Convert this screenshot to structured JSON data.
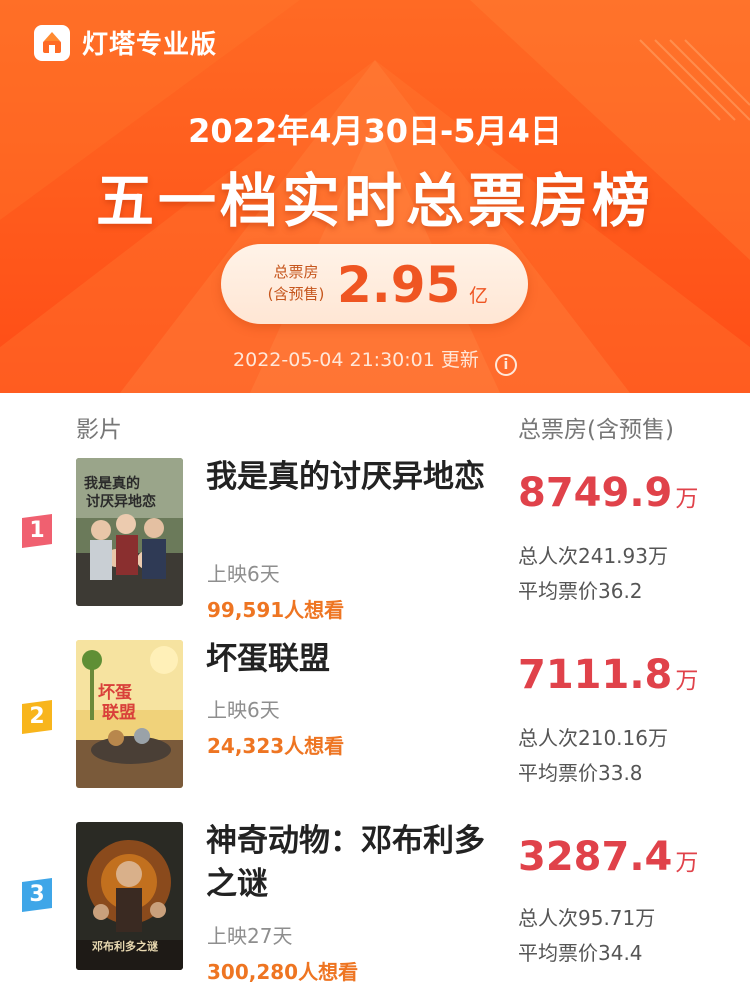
{
  "brand": {
    "name": "灯塔专业版"
  },
  "header": {
    "date_range": "2022年4月30日-5月4日",
    "title": "五一档实时总票房榜",
    "total_label_line1": "总票房",
    "total_label_line2": "(含预售)",
    "total_value": "2.95",
    "total_unit": "亿",
    "update_time": "2022-05-04 21:30:01",
    "update_label": "更新",
    "info_icon": "ⓘ"
  },
  "columns": {
    "film": "影片",
    "box_office": "总票房(含预售)"
  },
  "movies": [
    {
      "rank": "1",
      "title": "我是真的讨厌异地恋",
      "days": "上映6天",
      "want": "99,591人想看",
      "box_office": "8749.9",
      "box_unit": "万",
      "viewers": "总人次241.93万",
      "avg_price": "平均票价36.2",
      "badge_color": "#f06070"
    },
    {
      "rank": "2",
      "title": "坏蛋联盟",
      "days": "上映6天",
      "want": "24,323人想看",
      "box_office": "7111.8",
      "box_unit": "万",
      "viewers": "总人次210.16万",
      "avg_price": "平均票价33.8",
      "badge_color": "#f8b51c"
    },
    {
      "rank": "3",
      "title": "神奇动物：邓布利多之谜",
      "days": "上映27天",
      "want": "300,280人想看",
      "box_office": "3287.4",
      "box_unit": "万",
      "viewers": "总人次95.71万",
      "avg_price": "平均票价34.4",
      "badge_color": "#3fa6e8"
    }
  ]
}
